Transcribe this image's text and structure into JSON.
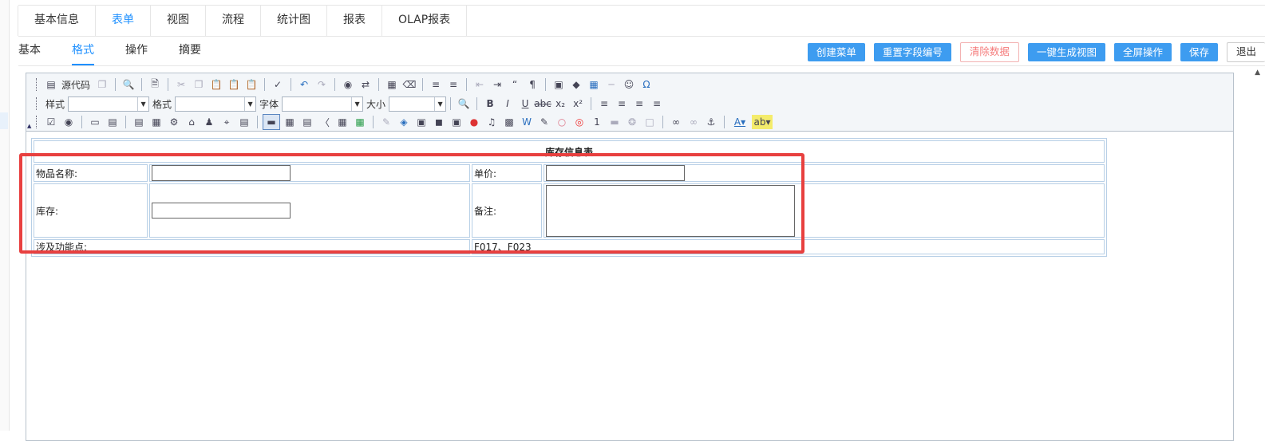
{
  "top_tabs": [
    "基本信息",
    "表单",
    "视图",
    "流程",
    "统计图",
    "报表",
    "OLAP报表"
  ],
  "active_top_tab": "表单",
  "sub_tabs": [
    "基本",
    "格式",
    "操作",
    "摘要"
  ],
  "active_sub_tab": "格式",
  "actions": {
    "create_menu": "创建菜单",
    "reset_field_numbers": "重置字段编号",
    "clear_data": "清除数据",
    "generate_view": "一键生成视图",
    "fullscreen": "全屏操作",
    "save": "保存",
    "exit": "退出"
  },
  "toolbar": {
    "source_label": "源代码",
    "style_label": "样式",
    "format_label": "格式",
    "font_label": "字体",
    "size_label": "大小"
  },
  "form": {
    "title": "库存信息表",
    "item_name_label": "物品名称:",
    "unit_price_label": "单价:",
    "stock_label": "库存:",
    "notes_label": "备注:",
    "function_points_label": "涉及功能点:",
    "function_points_value": "F017、F023"
  },
  "colors": {
    "accent": "#1e90ff",
    "button_blue": "#3d9cf0",
    "highlight_red": "#e8403f"
  }
}
